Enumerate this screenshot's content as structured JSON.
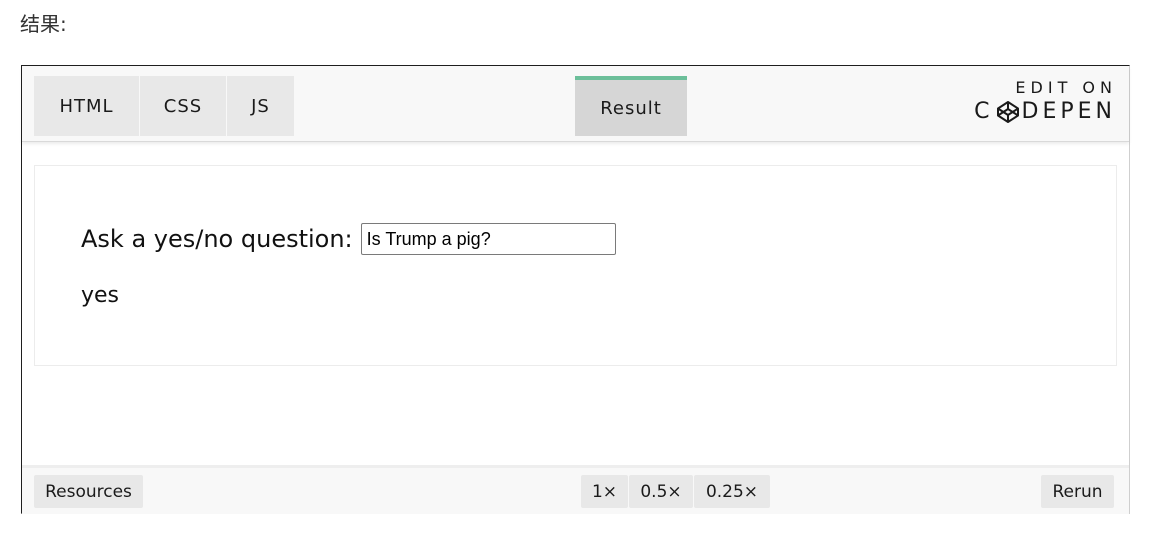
{
  "caption": "结果:",
  "tabs": {
    "html": "HTML",
    "css": "CSS",
    "js": "JS",
    "result": "Result"
  },
  "codepen": {
    "edit_on": "EDIT ON",
    "brand_left": "C",
    "brand_right": "DEPEN"
  },
  "result": {
    "question_label": "Ask a yes/no question:",
    "question_value": "Is Trump a pig?",
    "answer": "yes"
  },
  "bottom": {
    "resources": "Resources",
    "zoom_1": "1×",
    "zoom_05": "0.5×",
    "zoom_025": "0.25×",
    "rerun": "Rerun"
  },
  "colors": {
    "active_tab_accent": "#6cbf9a"
  }
}
